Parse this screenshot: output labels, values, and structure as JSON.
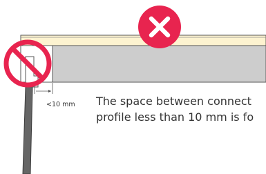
{
  "note": {
    "line1": "The space between connect",
    "line2": "profile less than 10 mm is fo"
  },
  "measurement": {
    "label": "<10 mm"
  },
  "icons": {
    "badge": "x-mark-icon",
    "prohibition": "prohibited-icon"
  },
  "colors": {
    "accent": "#e8244f",
    "profile_top": "#fdf3d0",
    "profile_bar": "#cdcdcd",
    "cable": "#666666",
    "text": "#333333"
  }
}
